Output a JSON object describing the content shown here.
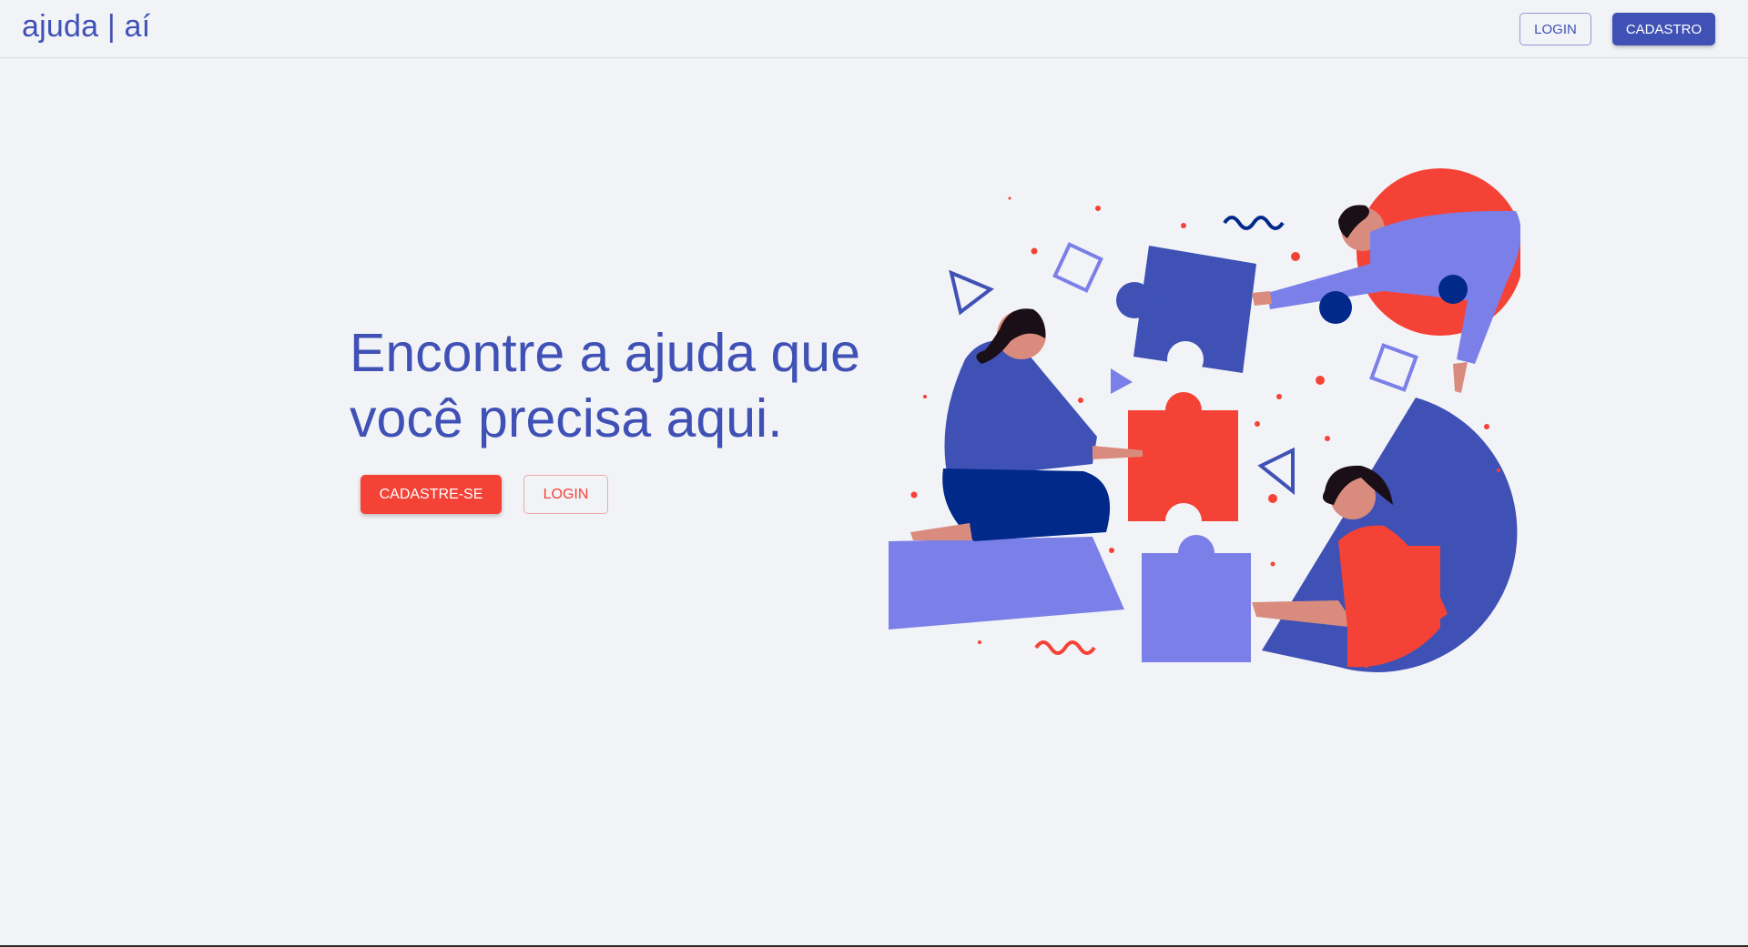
{
  "header": {
    "brand": "ajuda | aí",
    "login_label": "LOGIN",
    "signup_label": "CADASTRO"
  },
  "hero": {
    "title_line1": "Encontre a ajuda que",
    "title_line2": "você precisa aqui.",
    "signup_label": "CADASTRE-SE",
    "login_label": "LOGIN"
  },
  "illustration": {
    "name": "puzzle-teamwork-illustration"
  },
  "colors": {
    "primary": "#3f51b5",
    "accent": "#f44336",
    "light_blue": "#7b7fe8",
    "dark_blue": "#00298a",
    "background": "#f2f3f7"
  }
}
